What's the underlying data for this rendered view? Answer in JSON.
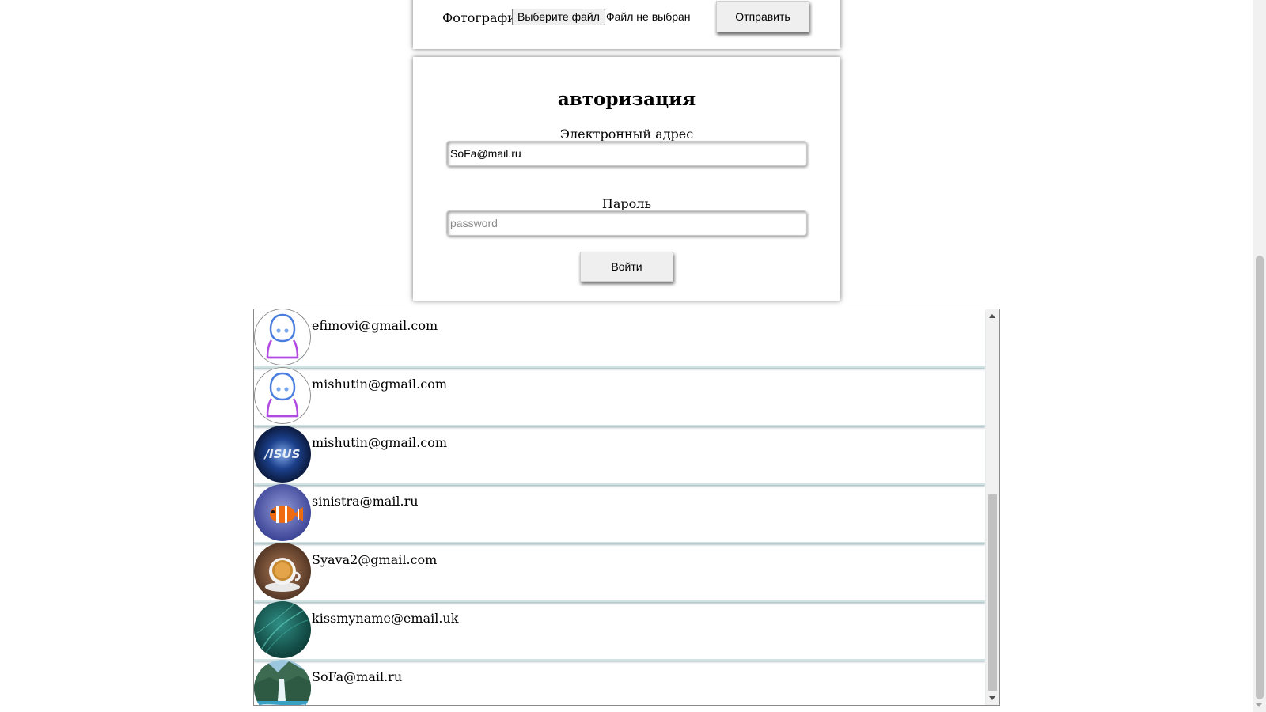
{
  "upload": {
    "photo_label": "Фотография",
    "choose_file_label": "Выберите файл",
    "file_status": "Файл не выбран",
    "send_label": "Отправить"
  },
  "auth": {
    "title": "авторизация",
    "email_label": "Электронный адрес",
    "email_value": "SoFa@mail.ru",
    "password_label": "Пароль",
    "password_placeholder": "password",
    "login_label": "Войти"
  },
  "users": [
    {
      "email": "efimovi@gmail.com",
      "avatar": "default-avatar-icon"
    },
    {
      "email": "mishutin@gmail.com",
      "avatar": "default-avatar-icon"
    },
    {
      "email": "mishutin@gmail.com",
      "avatar": "asus-logo-avatar"
    },
    {
      "email": "sinistra@mail.ru",
      "avatar": "clownfish-avatar"
    },
    {
      "email": "Syava2@gmail.com",
      "avatar": "coffee-cup-avatar"
    },
    {
      "email": "kissmyname@email.uk",
      "avatar": "green-abstract-avatar"
    },
    {
      "email": "SoFa@mail.ru",
      "avatar": "waterfall-landscape-avatar"
    }
  ],
  "colors": {
    "card_shadow": "#8c8c8c",
    "row_divider": "#cfe3e3",
    "button_bg": "#efefef"
  }
}
